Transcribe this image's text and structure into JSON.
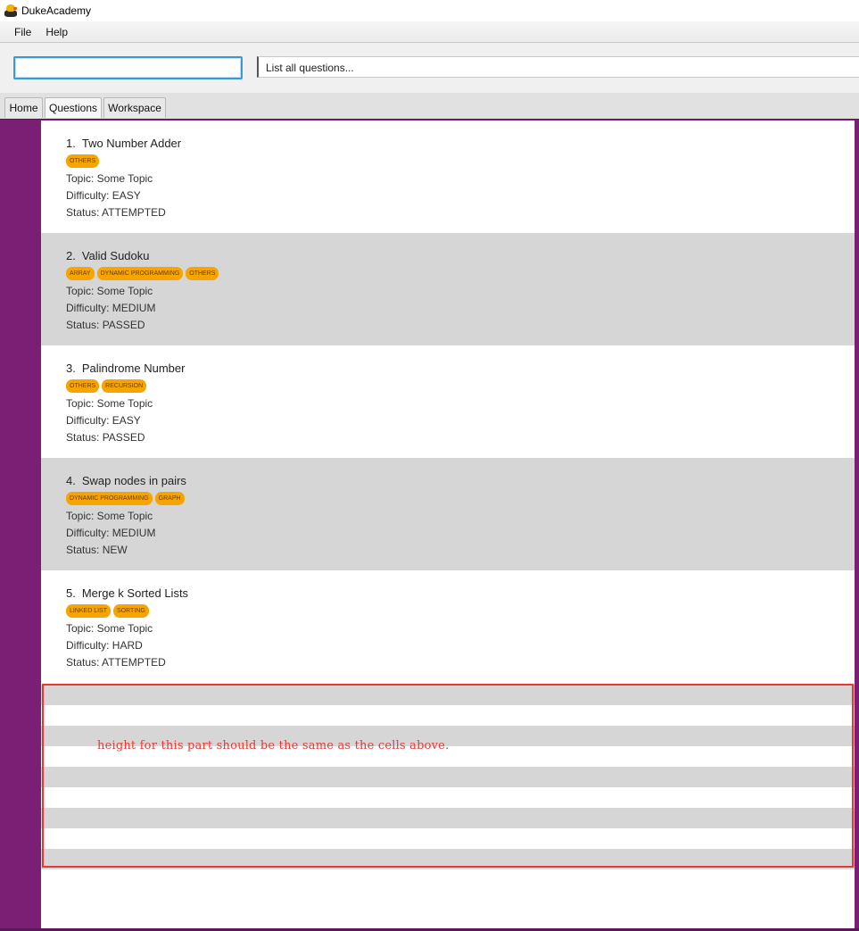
{
  "window": {
    "title": "DukeAcademy",
    "icon": "duke-icon"
  },
  "menu": {
    "items": [
      "File",
      "Help"
    ]
  },
  "command": {
    "input_value": "",
    "result_text": "List all questions..."
  },
  "tabs": [
    {
      "label": "Home",
      "selected": false
    },
    {
      "label": "Questions",
      "selected": true
    },
    {
      "label": "Workspace",
      "selected": false
    }
  ],
  "questions": [
    {
      "index": "1.",
      "title": "Two Number Adder",
      "tags": [
        "OTHERS"
      ],
      "topic": "Topic: Some Topic",
      "difficulty": "Difficulty: EASY",
      "status": "Status: ATTEMPTED"
    },
    {
      "index": "2.",
      "title": "Valid Sudoku",
      "tags": [
        "ARRAY",
        "DYNAMIC PROGRAMMING",
        "OTHERS"
      ],
      "topic": "Topic: Some Topic",
      "difficulty": "Difficulty: MEDIUM",
      "status": "Status: PASSED"
    },
    {
      "index": "3.",
      "title": "Palindrome Number",
      "tags": [
        "OTHERS",
        "RECURSION"
      ],
      "topic": "Topic: Some Topic",
      "difficulty": "Difficulty: EASY",
      "status": "Status: PASSED"
    },
    {
      "index": "4.",
      "title": "Swap nodes in pairs",
      "tags": [
        "DYNAMIC PROGRAMMING",
        "GRAPH"
      ],
      "topic": "Topic: Some Topic",
      "difficulty": "Difficulty: MEDIUM",
      "status": "Status: NEW"
    },
    {
      "index": "5.",
      "title": "Merge k Sorted Lists",
      "tags": [
        "LINKED LIST",
        "SORTING"
      ],
      "topic": "Topic: Some Topic",
      "difficulty": "Difficulty: HARD",
      "status": "Status: ATTEMPTED"
    }
  ],
  "annotation": {
    "text": "height for this part should be the same as the cells above."
  },
  "colors": {
    "accent": "#7b1f74",
    "tag": "#f6a500",
    "annotation": "#e53935",
    "row_alt": "#d6d6d6"
  }
}
